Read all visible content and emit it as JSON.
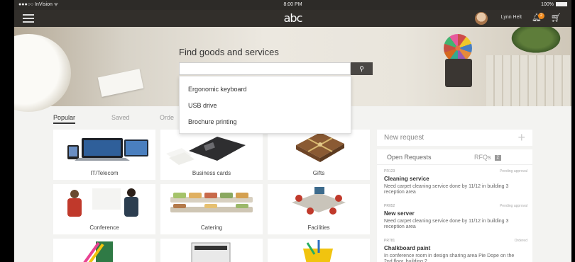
{
  "status_bar": {
    "carrier": "●●●○○ InVision ᯤ",
    "time": "8:00 PM",
    "battery": "100%"
  },
  "nav": {
    "logo": "abc",
    "user_name": "Lynn Helt",
    "notification_count": "2"
  },
  "hero": {
    "title": "Find goods and services",
    "search_value": "",
    "suggestions": [
      "Ergonomic keyboard",
      "USB drive",
      "Brochure printing"
    ]
  },
  "tabs": [
    "Popular",
    "Saved",
    "Orde"
  ],
  "tiles": [
    {
      "label": "IT/Telecom",
      "icon": "laptop-icon"
    },
    {
      "label": "Business cards",
      "icon": "business-card-icon"
    },
    {
      "label": "Gifts",
      "icon": "gift-box-icon"
    },
    {
      "label": "Conference",
      "icon": "people-meeting-icon"
    },
    {
      "label": "Catering",
      "icon": "food-trays-icon"
    },
    {
      "label": "Facilities",
      "icon": "office-furniture-icon"
    },
    {
      "label": "",
      "icon": "markers-icon"
    },
    {
      "label": "",
      "icon": "printer-icon"
    },
    {
      "label": "",
      "icon": "cleaning-bucket-icon"
    }
  ],
  "new_request": {
    "label": "New request",
    "plus": "+"
  },
  "requests_panel": {
    "tab_open": "Open Requests",
    "tab_rfqs": "RFQs",
    "rfq_count": "2",
    "items": [
      {
        "id": "PR123",
        "status": "Pending approval",
        "title": "Cleaning service",
        "desc": "Need carpet cleaning service done by 11/12 in building 3 reception area"
      },
      {
        "id": "PR052",
        "status": "Pending approval",
        "title": "New server",
        "desc": "Need carpet cleaning service done by 11/12 in building 3 reception area"
      },
      {
        "id": "PR781",
        "status": "Ordered",
        "title": "Chalkboard paint",
        "desc": "In conference room in design sharing area Pie Dope on the 2nd floor, building 2"
      }
    ]
  },
  "colors": {
    "nav_bg": "#322f2b",
    "search_button": "#4a4744",
    "badge": "#f08a1c"
  }
}
